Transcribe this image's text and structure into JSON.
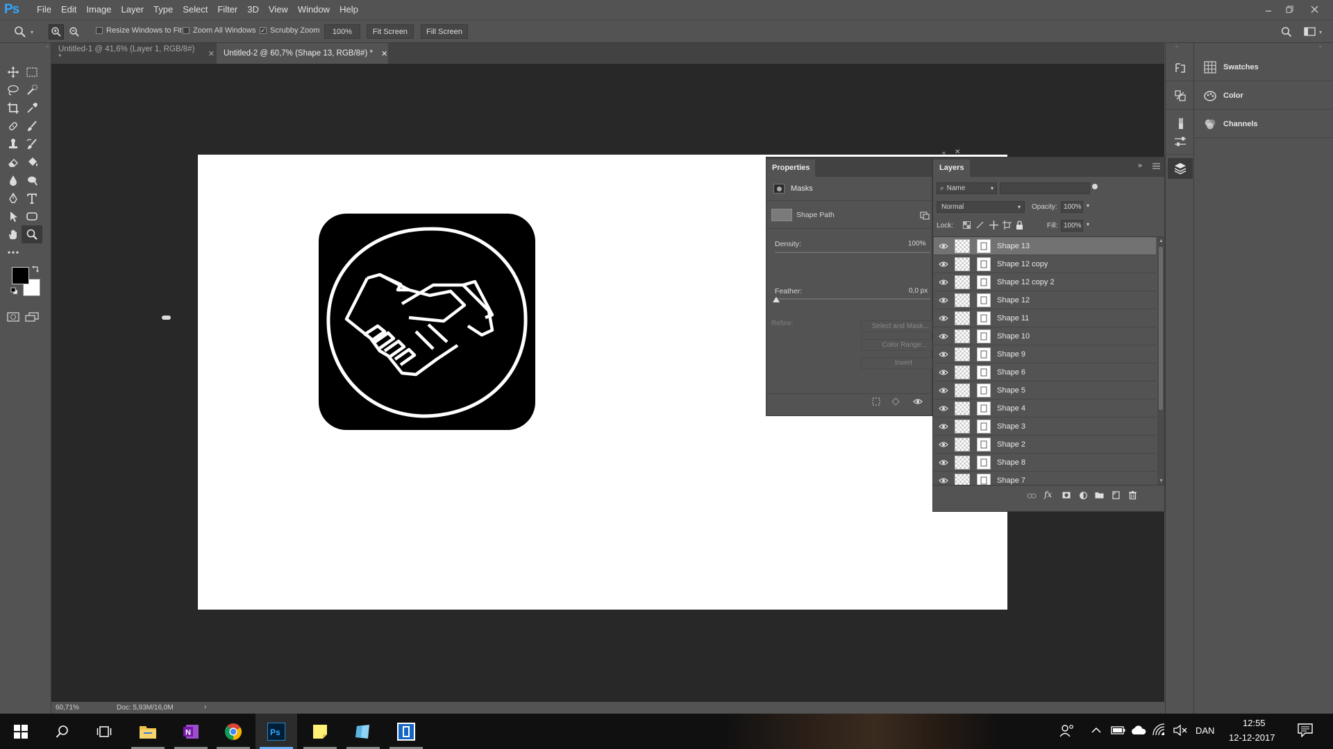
{
  "app": {
    "logo": "Ps",
    "menu": [
      "File",
      "Edit",
      "Image",
      "Layer",
      "Type",
      "Select",
      "Filter",
      "3D",
      "View",
      "Window",
      "Help"
    ]
  },
  "options": {
    "resize_windows": "Resize Windows to Fit",
    "zoom_all": "Zoom All Windows",
    "scrubby": "Scrubby Zoom",
    "zoom_value": "100%",
    "fit_screen": "Fit Screen",
    "fill_screen": "Fill Screen",
    "resize_checked": false,
    "zoom_all_checked": false,
    "scrubby_checked": true
  },
  "tabs": [
    {
      "label": "Untitled-1 @ 41,6% (Layer 1, RGB/8#) *",
      "active": false
    },
    {
      "label": "Untitled-2 @ 60,7% (Shape 13, RGB/8#) *",
      "active": true
    }
  ],
  "status": {
    "zoom": "60,71%",
    "doc": "Doc: 5,93M/16,0M",
    "arrow": "›"
  },
  "properties": {
    "title": "Properties",
    "section": "Masks",
    "shape_path": "Shape Path",
    "density_label": "Density:",
    "density_value": "100%",
    "feather_label": "Feather:",
    "feather_value": "0,0 px",
    "refine_label": "Refine:",
    "select_mask": "Select and Mask...",
    "color_range": "Color Range...",
    "invert": "Invert"
  },
  "layers": {
    "title": "Layers",
    "filter_kind": "Name",
    "blend_mode": "Normal",
    "opacity_label": "Opacity:",
    "opacity_value": "100%",
    "lock_label": "Lock:",
    "fill_label": "Fill:",
    "fill_value": "100%",
    "items": [
      {
        "name": "Shape 13",
        "selected": true
      },
      {
        "name": "Shape 12 copy",
        "selected": false
      },
      {
        "name": "Shape 12 copy 2",
        "selected": false
      },
      {
        "name": "Shape 12",
        "selected": false
      },
      {
        "name": "Shape 11",
        "selected": false
      },
      {
        "name": "Shape 10",
        "selected": false
      },
      {
        "name": "Shape 9",
        "selected": false
      },
      {
        "name": "Shape 6",
        "selected": false
      },
      {
        "name": "Shape 5",
        "selected": false
      },
      {
        "name": "Shape 4",
        "selected": false
      },
      {
        "name": "Shape 3",
        "selected": false
      },
      {
        "name": "Shape 2",
        "selected": false
      },
      {
        "name": "Shape 8",
        "selected": false
      },
      {
        "name": "Shape 7",
        "selected": false
      }
    ]
  },
  "right_panels": {
    "swatches": "Swatches",
    "color": "Color",
    "channels": "Channels"
  },
  "taskbar": {
    "language": "DAN",
    "time": "12:55",
    "date": "12-12-2017"
  },
  "colors": {
    "foreground": "#000000",
    "background": "#ffffff",
    "accent": "#31a8ff"
  }
}
